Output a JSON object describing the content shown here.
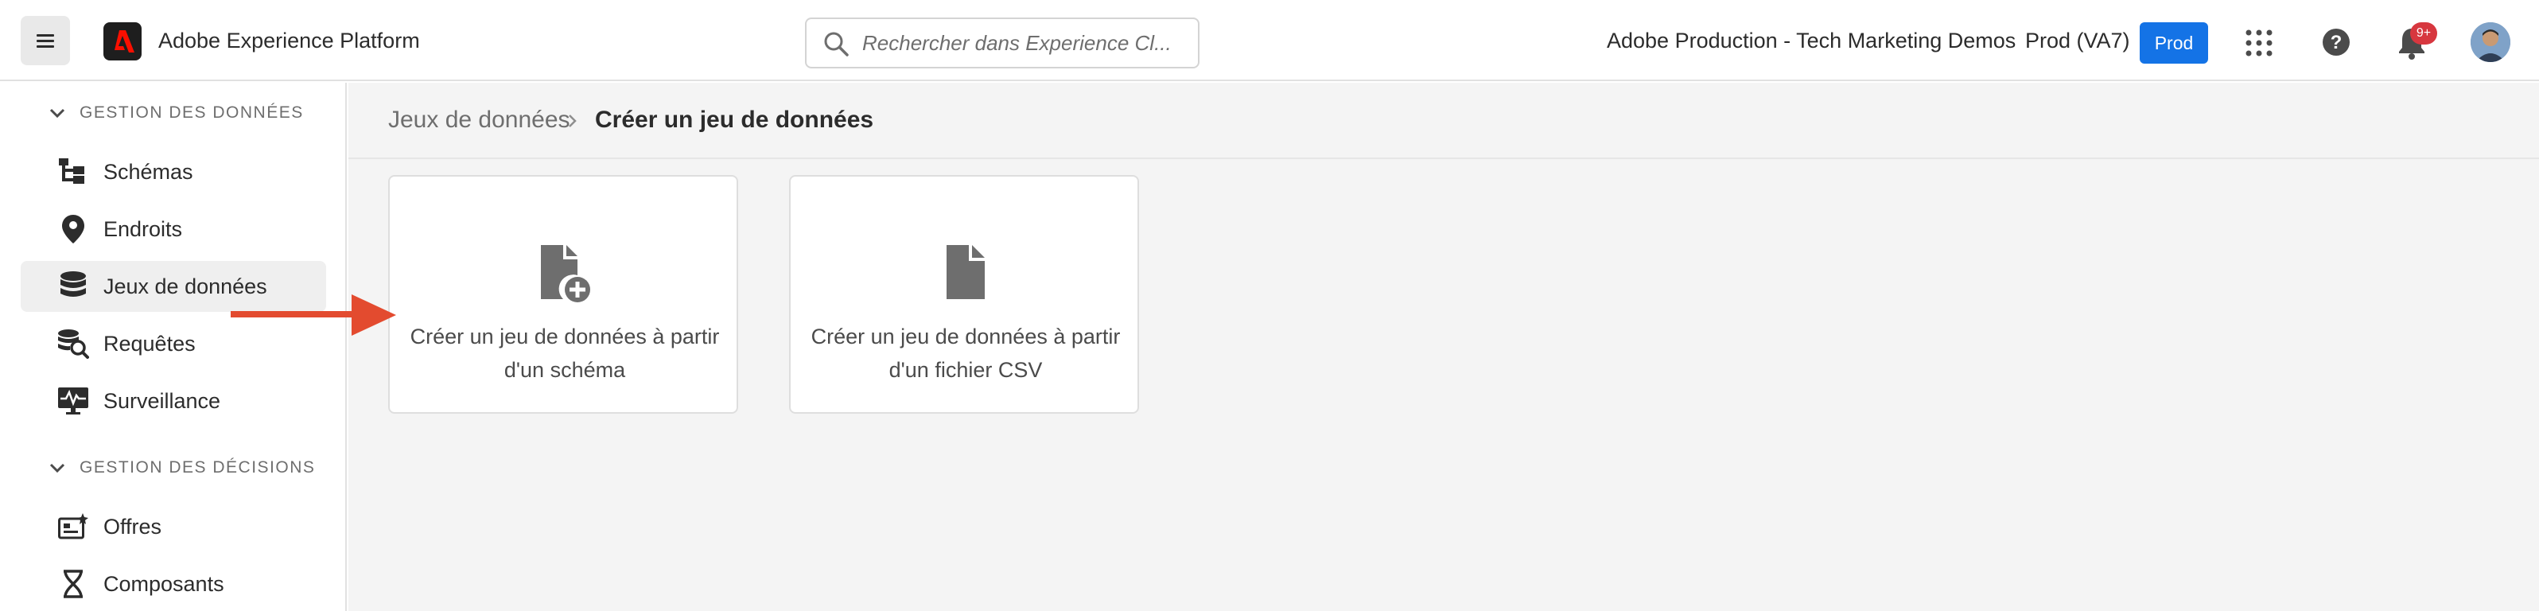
{
  "header": {
    "menu_label": "Menu",
    "app_title": "Adobe Experience Platform",
    "search_placeholder": "Rechercher dans Experience Cl...",
    "org_name": "Adobe Production - Tech Marketing Demos",
    "sandbox_name": "Prod (VA7)",
    "sandbox_badge": "Prod",
    "notification_count": "9+"
  },
  "sidebar": {
    "sections": [
      {
        "title": "GESTION DES DONNÉES",
        "items": [
          {
            "label": "Schémas",
            "icon": "schema-icon"
          },
          {
            "label": "Endroits",
            "icon": "location-pin-icon"
          },
          {
            "label": "Jeux de données",
            "icon": "database-icon",
            "active": true
          },
          {
            "label": "Requêtes",
            "icon": "query-icon"
          },
          {
            "label": "Surveillance",
            "icon": "monitoring-icon"
          }
        ]
      },
      {
        "title": "GESTION DES DÉCISIONS",
        "items": [
          {
            "label": "Offres",
            "icon": "offers-icon"
          },
          {
            "label": "Composants",
            "icon": "components-icon"
          }
        ]
      }
    ]
  },
  "breadcrumb": {
    "parent": "Jeux de données",
    "current": "Créer un jeu de données"
  },
  "cards": [
    {
      "label": "Créer un jeu de données à partir d'un schéma",
      "icon": "file-add-icon"
    },
    {
      "label": "Créer un jeu de données à partir d'un fichier CSV",
      "icon": "file-icon"
    }
  ],
  "colors": {
    "accent": "#1473e6",
    "badge_red": "#d7373f",
    "arrow_red": "#e34b2f"
  }
}
